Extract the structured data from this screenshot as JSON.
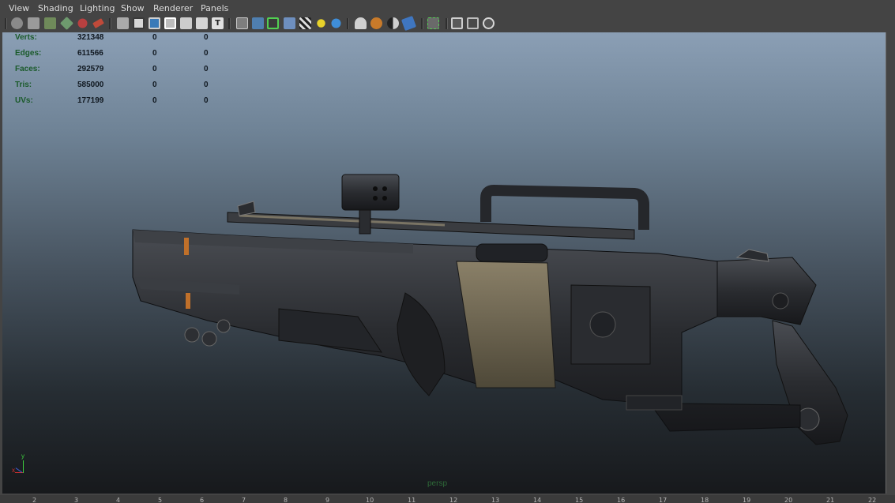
{
  "menubar": {
    "items": [
      {
        "label": "View"
      },
      {
        "label": "Shading"
      },
      {
        "label": "Lighting"
      },
      {
        "label": "Show"
      },
      {
        "label": "Renderer"
      },
      {
        "label": "Panels"
      }
    ]
  },
  "toolbar": {
    "icons": [
      "select-camera-icon",
      "lock-camera-icon",
      "camera-attributes-icon",
      "bookmarks-icon",
      "image-plane-icon",
      "two-d-pan-zoom-icon",
      "grease-pencil-icon",
      "grid-icon",
      "film-gate-icon",
      "resolution-gate-icon",
      "gate-mask-icon",
      "field-chart-icon",
      "safe-action-icon",
      "safe-title-icon",
      "wireframe-icon",
      "smooth-shade-icon",
      "wireframe-on-shaded-icon",
      "textured-icon",
      "checker-icon",
      "default-light-icon",
      "use-all-lights-icon",
      "shadows-icon",
      "screen-space-ambient-occlusion-icon",
      "motion-blur-icon",
      "anti-aliasing-icon",
      "isolate-select-icon",
      "xray-icon",
      "xray-joints-icon",
      "xray-components-icon"
    ]
  },
  "hud": {
    "rows": [
      {
        "label": "Verts:",
        "object": "321348",
        "selected": "0",
        "components": "0"
      },
      {
        "label": "Edges:",
        "object": "611566",
        "selected": "0",
        "components": "0"
      },
      {
        "label": "Faces:",
        "object": "292579",
        "selected": "0",
        "components": "0"
      },
      {
        "label": "Tris:",
        "object": "585000",
        "selected": "0",
        "components": "0"
      },
      {
        "label": "UVs:",
        "object": "177199",
        "selected": "0",
        "components": "0"
      }
    ]
  },
  "viewport": {
    "camera_label": "persp",
    "axis": {
      "y": "y",
      "x": "x"
    }
  },
  "timeline": {
    "ticks": [
      "2",
      "3",
      "4",
      "5",
      "6",
      "7",
      "8",
      "9",
      "10",
      "11",
      "12",
      "13",
      "14",
      "15",
      "16",
      "17",
      "18",
      "19",
      "20",
      "21",
      "22"
    ]
  },
  "colors": {
    "hud_label": "#1a5a2a",
    "selected_toggle": "#52d052",
    "model_dark": "#2a2c30",
    "accent_orange": "#c0702a"
  }
}
